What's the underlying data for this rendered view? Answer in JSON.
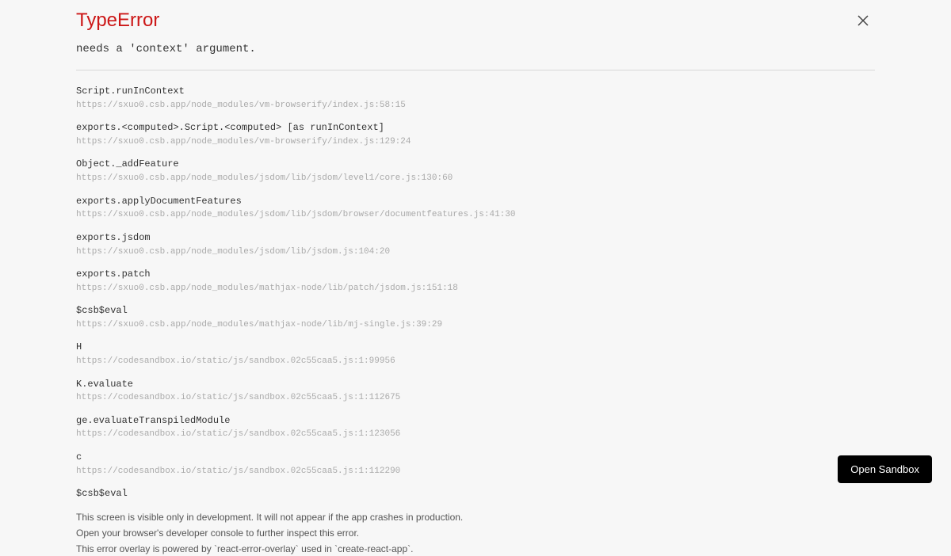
{
  "error": {
    "title": "TypeError",
    "message": "needs a 'context' argument."
  },
  "stack": [
    {
      "func": "Script.runInContext",
      "loc": "https://sxuo0.csb.app/node_modules/vm-browserify/index.js:58:15"
    },
    {
      "func": "exports.<computed>.Script.<computed> [as runInContext]",
      "loc": "https://sxuo0.csb.app/node_modules/vm-browserify/index.js:129:24"
    },
    {
      "func": "Object._addFeature",
      "loc": "https://sxuo0.csb.app/node_modules/jsdom/lib/jsdom/level1/core.js:130:60"
    },
    {
      "func": "exports.applyDocumentFeatures",
      "loc": "https://sxuo0.csb.app/node_modules/jsdom/lib/jsdom/browser/documentfeatures.js:41:30"
    },
    {
      "func": "exports.jsdom",
      "loc": "https://sxuo0.csb.app/node_modules/jsdom/lib/jsdom.js:104:20"
    },
    {
      "func": "exports.patch",
      "loc": "https://sxuo0.csb.app/node_modules/mathjax-node/lib/patch/jsdom.js:151:18"
    },
    {
      "func": "$csb$eval",
      "loc": "https://sxuo0.csb.app/node_modules/mathjax-node/lib/mj-single.js:39:29"
    },
    {
      "func": "H",
      "loc": "https://codesandbox.io/static/js/sandbox.02c55caa5.js:1:99956"
    },
    {
      "func": "K.evaluate",
      "loc": "https://codesandbox.io/static/js/sandbox.02c55caa5.js:1:112675"
    },
    {
      "func": "ge.evaluateTranspiledModule",
      "loc": "https://codesandbox.io/static/js/sandbox.02c55caa5.js:1:123056"
    },
    {
      "func": "c",
      "loc": "https://codesandbox.io/static/js/sandbox.02c55caa5.js:1:112290"
    },
    {
      "func": "$csb$eval",
      "loc": ""
    }
  ],
  "footer": {
    "line1": "This screen is visible only in development. It will not appear if the app crashes in production.",
    "line2": "Open your browser's developer console to further inspect this error.",
    "line3": "This error overlay is powered by `react-error-overlay` used in `create-react-app`."
  },
  "buttons": {
    "open_sandbox": "Open Sandbox"
  }
}
